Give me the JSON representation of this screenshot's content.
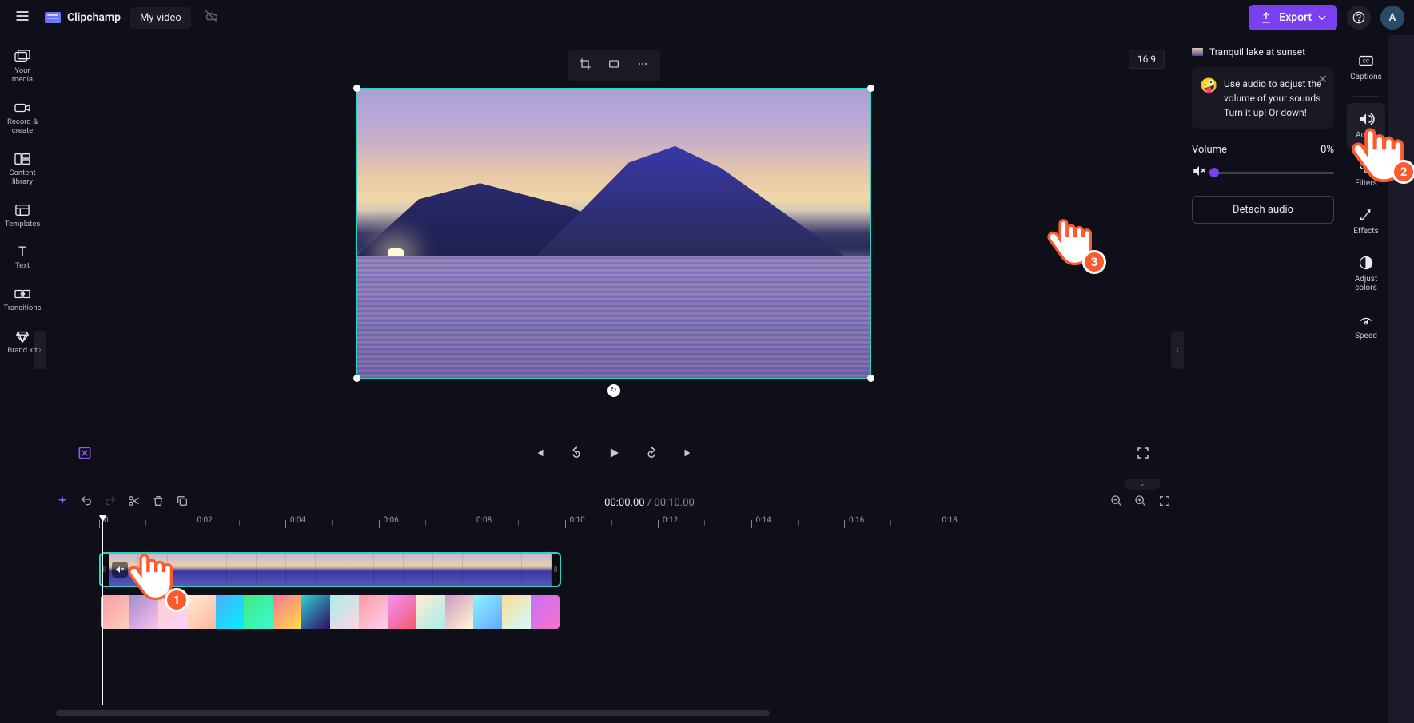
{
  "app": {
    "name": "Clipchamp",
    "title": "My video"
  },
  "header": {
    "export_label": "Export",
    "avatar_letter": "A"
  },
  "left_sidebar": {
    "items": [
      {
        "label": "Your media",
        "icon": "media-icon"
      },
      {
        "label": "Record & create",
        "icon": "record-icon"
      },
      {
        "label": "Content library",
        "icon": "library-icon"
      },
      {
        "label": "Templates",
        "icon": "templates-icon"
      },
      {
        "label": "Text",
        "icon": "text-icon"
      },
      {
        "label": "Transitions",
        "icon": "transitions-icon"
      },
      {
        "label": "Brand kit",
        "icon": "brandkit-icon"
      }
    ]
  },
  "stage": {
    "aspect": "16:9"
  },
  "playback": {
    "current": "00:00.00",
    "separator": " / ",
    "total": "00:10.00"
  },
  "timeline": {
    "ruler": [
      "0",
      "0:02",
      "0:04",
      "0:06",
      "0:08",
      "0:10",
      "0:12",
      "0:14",
      "0:16",
      "0:18"
    ]
  },
  "right_panel": {
    "clip_title": "Tranquil lake at sunset",
    "tip_text": "Use audio to adjust the volume of your sounds. Turn it up! Or down!",
    "volume_label": "Volume",
    "volume_value": "0%",
    "detach_label": "Detach audio"
  },
  "right_sidebar": {
    "items": [
      {
        "label": "Captions",
        "icon": "captions-icon"
      },
      {
        "label": "Audio",
        "icon": "audio-icon",
        "active": true
      },
      {
        "label": "Filters",
        "icon": "filters-icon"
      },
      {
        "label": "Effects",
        "icon": "effects-icon"
      },
      {
        "label": "Adjust colors",
        "icon": "adjust-icon"
      },
      {
        "label": "Speed",
        "icon": "speed-icon"
      }
    ]
  },
  "annotations": {
    "step1": "1",
    "step2": "2",
    "step3": "3"
  }
}
